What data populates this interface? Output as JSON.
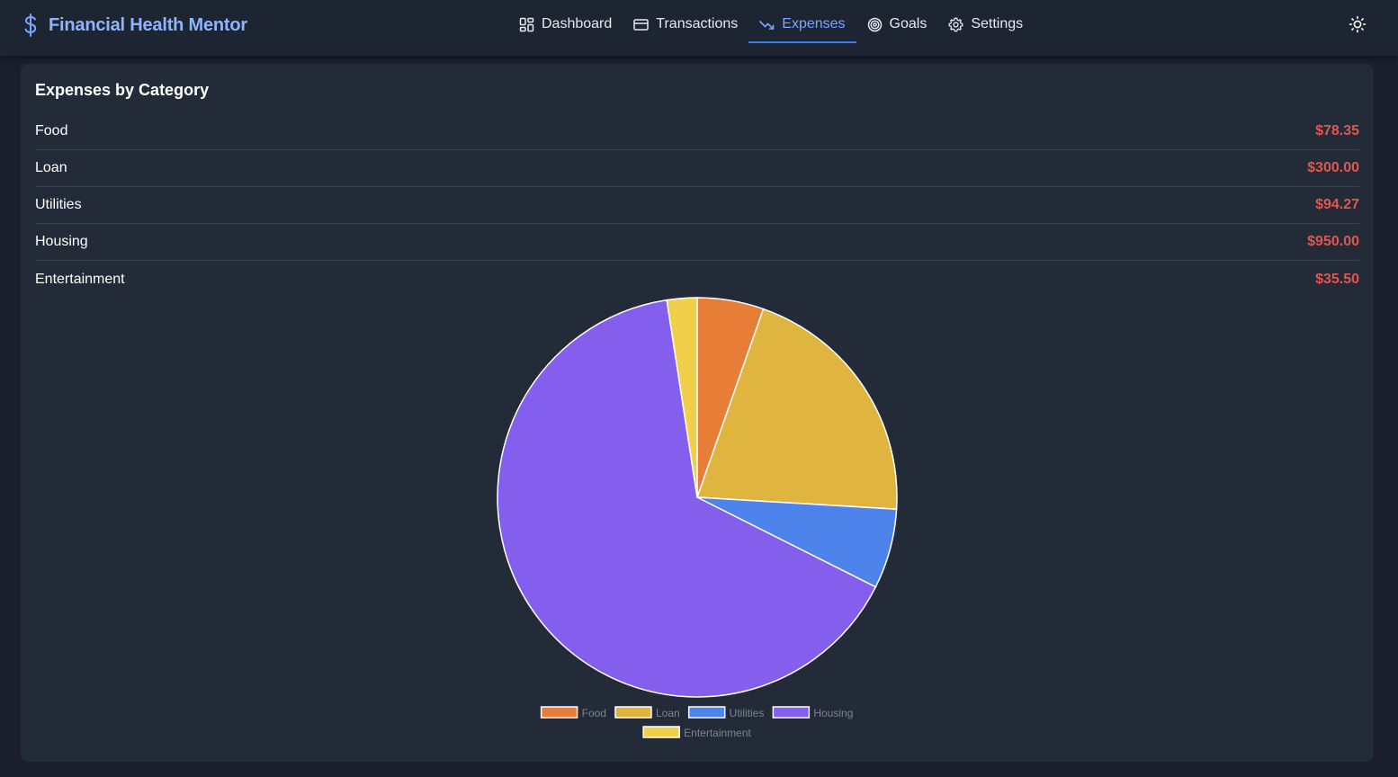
{
  "app": {
    "title": "Financial Health Mentor",
    "brand_color": "#8fb4ff"
  },
  "nav": {
    "items": [
      {
        "label": "Dashboard",
        "icon": "dashboard-grid-icon",
        "active": false
      },
      {
        "label": "Transactions",
        "icon": "credit-card-icon",
        "active": false
      },
      {
        "label": "Expenses",
        "icon": "trending-down-icon",
        "active": true
      },
      {
        "label": "Goals",
        "icon": "target-icon",
        "active": false
      },
      {
        "label": "Settings",
        "icon": "gear-icon",
        "active": false
      }
    ],
    "theme_toggle_icon": "sun-icon"
  },
  "expenses": {
    "title": "Expenses by Category",
    "rows": [
      {
        "category": "Food",
        "amount": "$78.35"
      },
      {
        "category": "Loan",
        "amount": "$300.00"
      },
      {
        "category": "Utilities",
        "amount": "$94.27"
      },
      {
        "category": "Housing",
        "amount": "$950.00"
      },
      {
        "category": "Entertainment",
        "amount": "$35.50"
      }
    ]
  },
  "chart_data": {
    "type": "pie",
    "categories": [
      "Food",
      "Loan",
      "Utilities",
      "Housing",
      "Entertainment"
    ],
    "values": [
      78.35,
      300.0,
      94.27,
      950.0,
      35.5
    ],
    "colors": [
      "#e87d38",
      "#e0b53f",
      "#4f83ec",
      "#845eec",
      "#f2cf4a"
    ],
    "legend_position": "bottom",
    "start_angle": "top, clockwise"
  }
}
